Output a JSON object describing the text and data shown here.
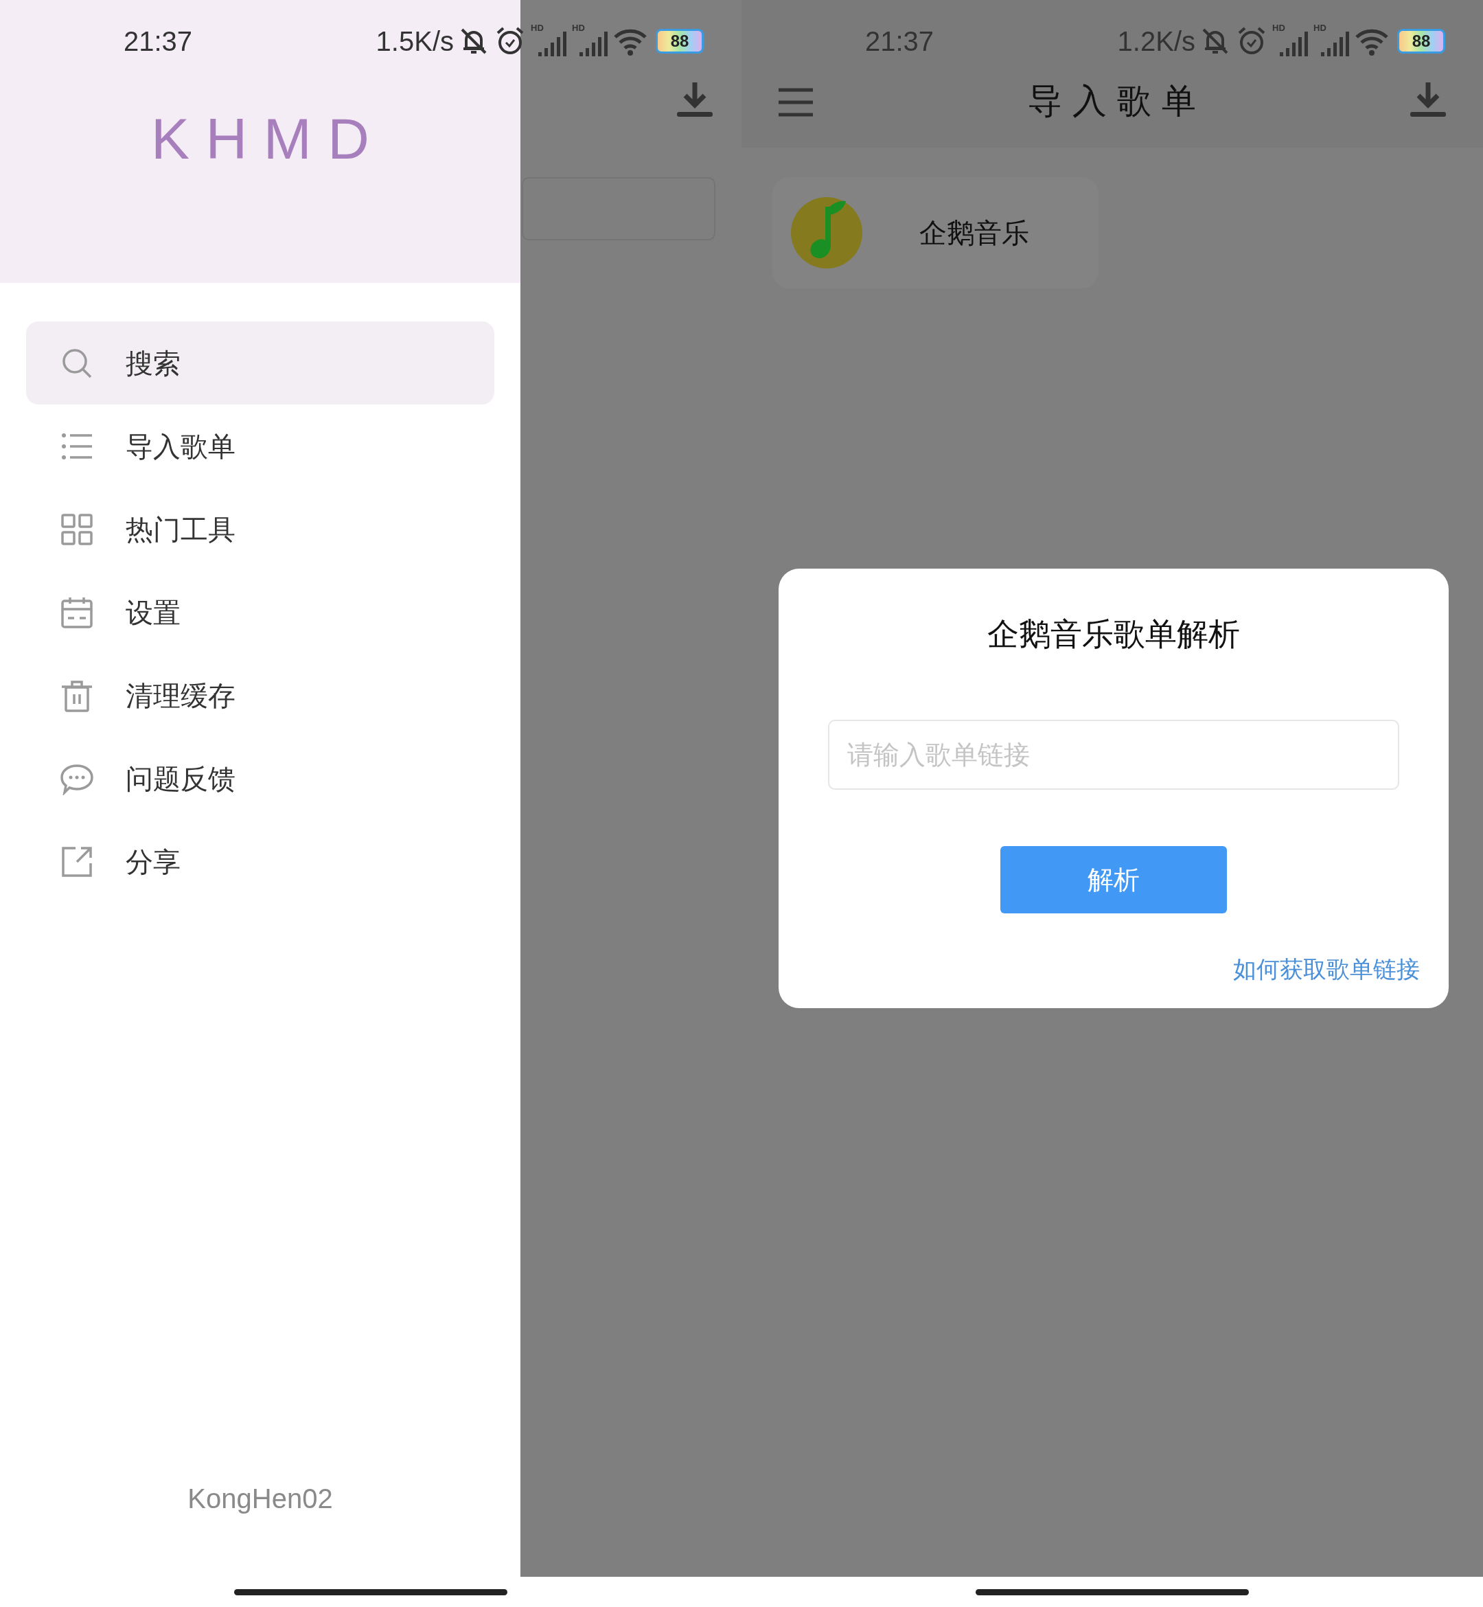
{
  "left_screen": {
    "status_bar": {
      "time": "21:37",
      "net_speed": "1.5K/s",
      "signal_labels": [
        "HD",
        "HD"
      ],
      "battery": "88"
    },
    "drawer": {
      "logo": "KHMD",
      "footer": "KongHen02",
      "items": [
        {
          "label": "搜索",
          "selected": true
        },
        {
          "label": "导入歌单",
          "selected": false
        },
        {
          "label": "热门工具",
          "selected": false
        },
        {
          "label": "设置",
          "selected": false
        },
        {
          "label": "清理缓存",
          "selected": false
        },
        {
          "label": "问题反馈",
          "selected": false
        },
        {
          "label": "分享",
          "selected": false
        }
      ]
    }
  },
  "right_screen": {
    "status_bar": {
      "time": "21:37",
      "net_speed": "1.2K/s",
      "signal_labels": [
        "HD",
        "HD"
      ],
      "battery": "88"
    },
    "app_bar": {
      "title": "导入歌单"
    },
    "sources": [
      {
        "label": "企鹅音乐"
      }
    ],
    "dialog": {
      "title": "企鹅音乐歌单解析",
      "input": {
        "placeholder": "请输入歌单链接"
      },
      "button": "解析",
      "link": "如何获取歌单链接"
    }
  }
}
